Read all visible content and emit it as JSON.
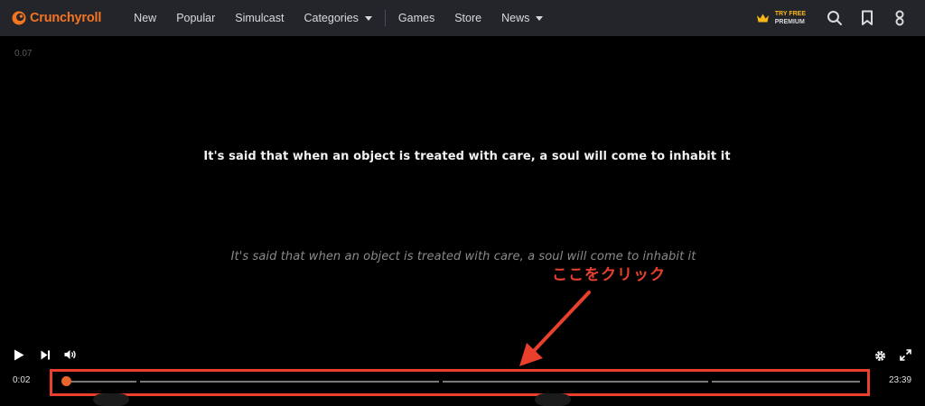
{
  "brand": {
    "name": "Crunchyroll",
    "color": "#f47521"
  },
  "nav": {
    "items": [
      {
        "label": "New"
      },
      {
        "label": "Popular"
      },
      {
        "label": "Simulcast"
      },
      {
        "label": "Categories"
      },
      {
        "label": "Games"
      },
      {
        "label": "Store"
      },
      {
        "label": "News"
      }
    ],
    "premium": {
      "line1": "TRY FREE",
      "line2": "PREMIUM",
      "icon": "crown-icon"
    },
    "icons": [
      "search-icon",
      "bookmark-icon",
      "user-icon"
    ]
  },
  "player": {
    "version": "0.07",
    "subtitle_primary": "It's said that when an object is treated with care, a soul will come to inhabit it",
    "subtitle_secondary": "It's said that when an object is treated with care, a soul will come to inhabit it",
    "current_time": "0:02",
    "duration": "23:39",
    "progress_fraction": 0.0014,
    "controls": [
      "play-icon",
      "next-icon",
      "volume-icon",
      "settings-icon",
      "fullscreen-icon"
    ]
  },
  "annotation": {
    "text": "ここをクリック",
    "color": "#e8402d"
  }
}
